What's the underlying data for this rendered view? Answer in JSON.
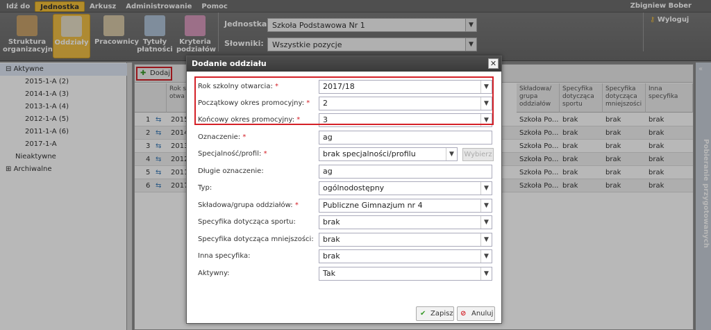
{
  "topmenu": {
    "items": [
      "Idź do",
      "Jednostka",
      "Arkusz",
      "Administrowanie",
      "Pomoc"
    ],
    "active_index": 1,
    "user": "Zbigniew Bober"
  },
  "toolbar": {
    "buttons": [
      {
        "label": "Struktura\norganizacyjna",
        "icon": "building-icon"
      },
      {
        "label": "Oddziały",
        "icon": "class-group-icon"
      },
      {
        "label": "Pracownicy",
        "icon": "employees-icon"
      },
      {
        "label": "Tytuły\npłatności",
        "icon": "payment-titles-icon"
      },
      {
        "label": "Kryteria\npodziałów",
        "icon": "split-criteria-icon"
      }
    ],
    "unit_label": "Jednostka:",
    "unit_value": "Szkoła Podstawowa Nr 1",
    "dict_label": "Słowniki:",
    "dict_value": "Wszystkie pozycje",
    "logout": "Wyloguj"
  },
  "tree": {
    "active_label": "Aktywne",
    "active_children": [
      "2015-1-A (2)",
      "2014-1-A (3)",
      "2013-1-A (4)",
      "2012-1-A (5)",
      "2011-1-A (6)",
      "2017-1-A"
    ],
    "inactive_label": "Nieaktywne",
    "archive_label": "Archiwalne"
  },
  "grid": {
    "add_label": "Dodaj",
    "headers": {
      "rok": "Rok s\notwa",
      "skladowa": "Składowa/\ngrupa\noddziałów",
      "sport": "Specyfika\ndotycząca\nsportu",
      "mniejsz": "Specyfika\ndotycząca\nmniejszości",
      "inna": "Inna\nspecyfika"
    },
    "rows": [
      {
        "n": "1",
        "rok": "2015",
        "skl": "Szkoła Po...",
        "sport": "brak",
        "mn": "brak",
        "inna": "brak"
      },
      {
        "n": "2",
        "rok": "2014",
        "skl": "Szkoła Po...",
        "sport": "brak",
        "mn": "brak",
        "inna": "brak"
      },
      {
        "n": "3",
        "rok": "2013",
        "skl": "Szkoła Po...",
        "sport": "brak",
        "mn": "brak",
        "inna": "brak"
      },
      {
        "n": "4",
        "rok": "2012",
        "skl": "Szkoła Po...",
        "sport": "brak",
        "mn": "brak",
        "inna": "brak"
      },
      {
        "n": "5",
        "rok": "2011",
        "skl": "Szkoła Po...",
        "sport": "brak",
        "mn": "brak",
        "inna": "brak"
      },
      {
        "n": "6",
        "rok": "2017",
        "skl": "Szkoła Po...",
        "sport": "brak",
        "mn": "brak",
        "inna": "brak"
      }
    ]
  },
  "rightpanel": {
    "label": "Pobieranie przygotowanych"
  },
  "dialog": {
    "title": "Dodanie oddziału",
    "fields": [
      {
        "label": "Rok szkolny otwarcia:",
        "req": true,
        "value": "2017/18",
        "kind": "select"
      },
      {
        "label": "Początkowy okres promocyjny:",
        "req": true,
        "value": "2",
        "kind": "select"
      },
      {
        "label": "Końcowy okres promocyjny:",
        "req": true,
        "value": "3",
        "kind": "select"
      },
      {
        "label": "Oznaczenie:",
        "req": true,
        "value": "ag",
        "kind": "text"
      },
      {
        "label": "Specjalność/profil:",
        "req": true,
        "value": "brak specjalności/profilu",
        "kind": "select-short"
      },
      {
        "label": "Długie oznaczenie:",
        "req": false,
        "value": "ag",
        "kind": "text"
      },
      {
        "label": "Typ:",
        "req": false,
        "value": "ogólnodostępny",
        "kind": "select"
      },
      {
        "label": "Składowa/grupa oddziałów:",
        "req": true,
        "value": "Publiczne Gimnazjum nr 4",
        "kind": "select"
      },
      {
        "label": "Specyfika dotycząca sportu:",
        "req": false,
        "value": "brak",
        "kind": "select"
      },
      {
        "label": "Specyfika dotycząca mniejszości:",
        "req": false,
        "value": "brak",
        "kind": "select"
      },
      {
        "label": "Inna specyfika:",
        "req": false,
        "value": "brak",
        "kind": "select"
      },
      {
        "label": "Aktywny:",
        "req": false,
        "value": "Tak",
        "kind": "select"
      }
    ],
    "wybierz": "Wybierz",
    "save": "Zapisz",
    "cancel": "Anuluj"
  }
}
